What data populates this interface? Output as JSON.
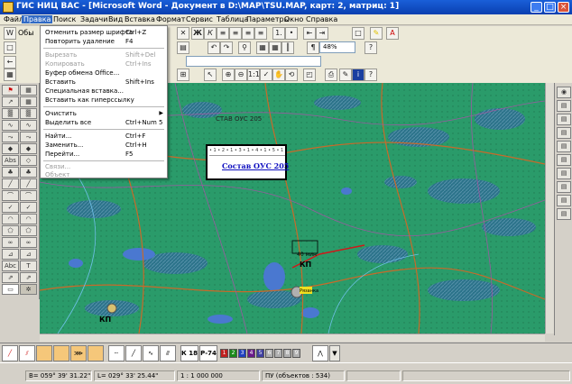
{
  "window": {
    "title": "ГИС НИЦ ВАС - [Microsoft Word  - Документ в D:\\MAP\\TSU.MAP, карт: 2, матриц: 1]"
  },
  "menubar": [
    "Файл",
    "Правка",
    "Поиск",
    "Задачи",
    "Вид",
    "Вставка",
    "Формат",
    "Сервис",
    "Таблица",
    "Параметры",
    "Окно",
    "Справка"
  ],
  "edit_menu": {
    "items": [
      {
        "label": "Отменить размер шрифта",
        "shortcut": "Ctrl+Z",
        "enabled": true
      },
      {
        "label": "Повторить удаление",
        "shortcut": "F4",
        "enabled": true
      },
      {
        "label": "Вырезать",
        "shortcut": "Shift+Del",
        "enabled": false
      },
      {
        "label": "Копировать",
        "shortcut": "Ctrl+Ins",
        "enabled": false
      },
      {
        "label": "Буфер обмена Office...",
        "shortcut": "",
        "enabled": true
      },
      {
        "label": "Вставить",
        "shortcut": "Shift+Ins",
        "enabled": true
      },
      {
        "label": "Специальная вставка...",
        "shortcut": "",
        "enabled": true
      },
      {
        "label": "Вставить как гиперссылку",
        "shortcut": "",
        "enabled": true
      },
      {
        "label": "Очистить",
        "shortcut": "",
        "enabled": true,
        "submenu": true
      },
      {
        "label": "Выделить все",
        "shortcut": "Ctrl+Num 5",
        "enabled": true
      },
      {
        "label": "Найти...",
        "shortcut": "Ctrl+F",
        "enabled": true
      },
      {
        "label": "Заменить...",
        "shortcut": "Ctrl+H",
        "enabled": true
      },
      {
        "label": "Перейти...",
        "shortcut": "F5",
        "enabled": true
      },
      {
        "label": "Связи...",
        "shortcut": "",
        "enabled": false
      },
      {
        "label": "Объект",
        "shortcut": "",
        "enabled": false
      }
    ]
  },
  "toolbar": {
    "zoom": "48%",
    "toolbar_label": "Обы"
  },
  "map": {
    "popup_link": "Состав ОУС 205",
    "popup_ruler": "• 1 • 2 • 1 • 3 • 1 • 4 • 1 • 5 • 1 • 6",
    "labels": [
      "КП",
      "КП",
      "40 мин",
      "Рязанка",
      "СТАВ ОУС 205"
    ]
  },
  "bottom_strip": {
    "labels": [
      "К 18",
      "Р-74"
    ],
    "swatches": [
      "1",
      "2",
      "3",
      "4",
      "5",
      "6",
      "7",
      "8",
      "9"
    ],
    "swatch_colors": [
      "#c02020",
      "#1a8a1a",
      "#2040c0",
      "#6a1a8a",
      "#4040a0",
      "#b0b0b0",
      "#b0b0b0",
      "#b0b0b0",
      "#b0b0b0"
    ]
  },
  "status": {
    "b": "B= 059° 39' 31.22\"",
    "l": "L= 029° 33' 25.44\"",
    "scale": "1 : 1 000 000",
    "objects": "ПУ   (объектов : 534)"
  },
  "colors": {
    "map_green": "#2a9b6a",
    "menu_highlight": "#316ac5",
    "titlebar": "#0a3fb0"
  }
}
